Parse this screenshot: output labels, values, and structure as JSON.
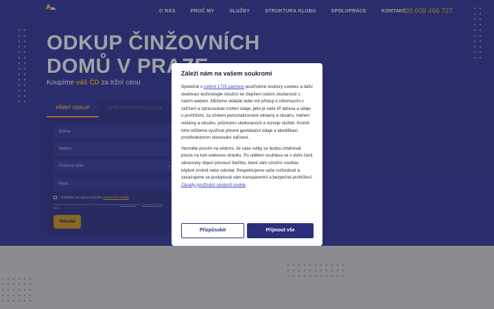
{
  "header": {
    "nav": [
      "O NÁS",
      "PROČ MY",
      "SLUŽBY",
      "STRUKTURA KLUBU",
      "SPOLUPRÁCE",
      "KONTAKT"
    ],
    "phone": "+420 608 466 727"
  },
  "hero": {
    "title": "ODKUP ČINŽOVNÍCH DOMŮ V PRAZE",
    "subtitle_before": "Koupíme",
    "subtitle_highlight": "váš ČD",
    "subtitle_after": "za tržní cenu"
  },
  "form": {
    "tab_active": "PŘÍMÝ ODKUP",
    "tab_inactive": "SPOLEČNÁ REALIZACE",
    "name_placeholder": "Jméno",
    "phone_placeholder": "Telefon",
    "type_select": "Činžovní dům",
    "desc_placeholder": "Popis",
    "consent_text": "Souhlas se zpracováním",
    "consent_link": "osobních údajů",
    "recaptcha_text": "This site is protected by reCAPTCHA and the Google",
    "recaptcha_privacy": "Privacy Policy",
    "recaptcha_and": "and",
    "recaptcha_terms": "Terms of Service",
    "recaptcha_apply": "apply.",
    "submit": "Odeslat"
  },
  "modal": {
    "title": "Záleží nám na vašem soukromí",
    "p1_before": "Společně s",
    "p1_link": "našimi 1725 partnery",
    "p1_after": "používáme soubory cookies a další sledovací technologie sloužící ke zlepšení vašich zkušeností s naším webem. Můžeme ukládat nebo mít přístup k informacím v zařízení a zpracovávat osobní údaje, jako je vaše IP adresa a údaje o prohlížení, za účelem personalizované reklamy a obsahu, měření reklamy a obsahu, průzkumu sledovanosti a rozvoje služeb. Kromě toho můžeme využívat přesné geolokační údaje a identifikaci prostřednictvím skenování zařízení.",
    "p2": "Vezměte prosím na vědomí, že vaše volby se budou vztahovat pouze na tuto webovou stránku. Po udělení souhlasu se v dolní části obrazovky objeví plovoucí tlačítko, které vám umožní souhlas kdykoli změnit nebo odvolat. Respektujeme vaše rozhodnutí a zavazujeme se poskytovat vám transparentní a bezpečné prohlížení.",
    "policy_link": "Zásady používání souborů cookie",
    "btn_customize": "Přizpůsobit",
    "btn_accept": "Přijmout vše"
  },
  "colors": {
    "hero_bg": "#3a3f9e",
    "accent": "#f0b43c",
    "modal_button": "#2a2f7a"
  }
}
